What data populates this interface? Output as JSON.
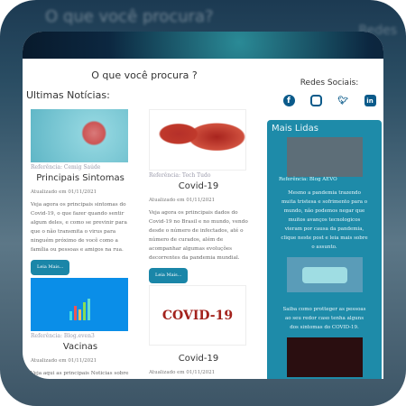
{
  "header": {
    "search_label": "O que você procura ?"
  },
  "latest": {
    "heading": "Ultimas Notícias:",
    "cards": [
      {
        "ref": "Referência: Cemig Saúde",
        "title": "Principais Sintomas",
        "date": "Atualizado em 01/11/2021",
        "desc": "Veja agora os principais sintomas do Covid-19, o que fazer quando sentir algum deles, e como se previnir para que o não transmita o virus para ninguém próximo de você como a família ou pessoas e amigos na rua.",
        "button": "Leia Mais..."
      },
      {
        "ref": "Referência: Tech Tudo",
        "title": "Covid-19",
        "date": "Atualizado em 01/11/2021",
        "desc": "Veja agora os priincipais dados do Covid-19 no Brasil e no mundo, vendo desde o número de infectados, até o número de curados, além de acompanhar algumas evoluções decorrentes da pandemia mundial.",
        "button": "Leia Mais..."
      },
      {
        "ref": "Referência: Blog.even3",
        "title": "Vacinas",
        "date": "Atualizado em 01/11/2021",
        "desc": "Veja aqui as principais Noticias sobre as vacinas que estão sendo aplicadas no"
      },
      {
        "image_text": "COVID-19",
        "title": "Covid-19",
        "date": "Atualizado em 01/11/2021"
      }
    ]
  },
  "social": {
    "label": "Redes Sociais:",
    "icons": [
      "facebook-icon",
      "instagram-icon",
      "twitter-icon",
      "linkedin-icon"
    ]
  },
  "most_read": {
    "heading": "Mais Lidas",
    "items": [
      {
        "ref": "Referência: Blog AEVO",
        "text": "Mesmo a pandemia trazendo muita tristesa e sofrimento para o mundo, não podemos negar que muitos avanços tecnologicos vieram por causa da pandemia, clique neste post e leia mais sobre o assunto."
      },
      {
        "text": "Saiba como protteger as pessoas ao seu redor caso tenha alguns dos sintomas do COVID-19."
      }
    ]
  },
  "background": {
    "blur_text": "O que você procura?",
    "blur_text2": "Redes"
  }
}
